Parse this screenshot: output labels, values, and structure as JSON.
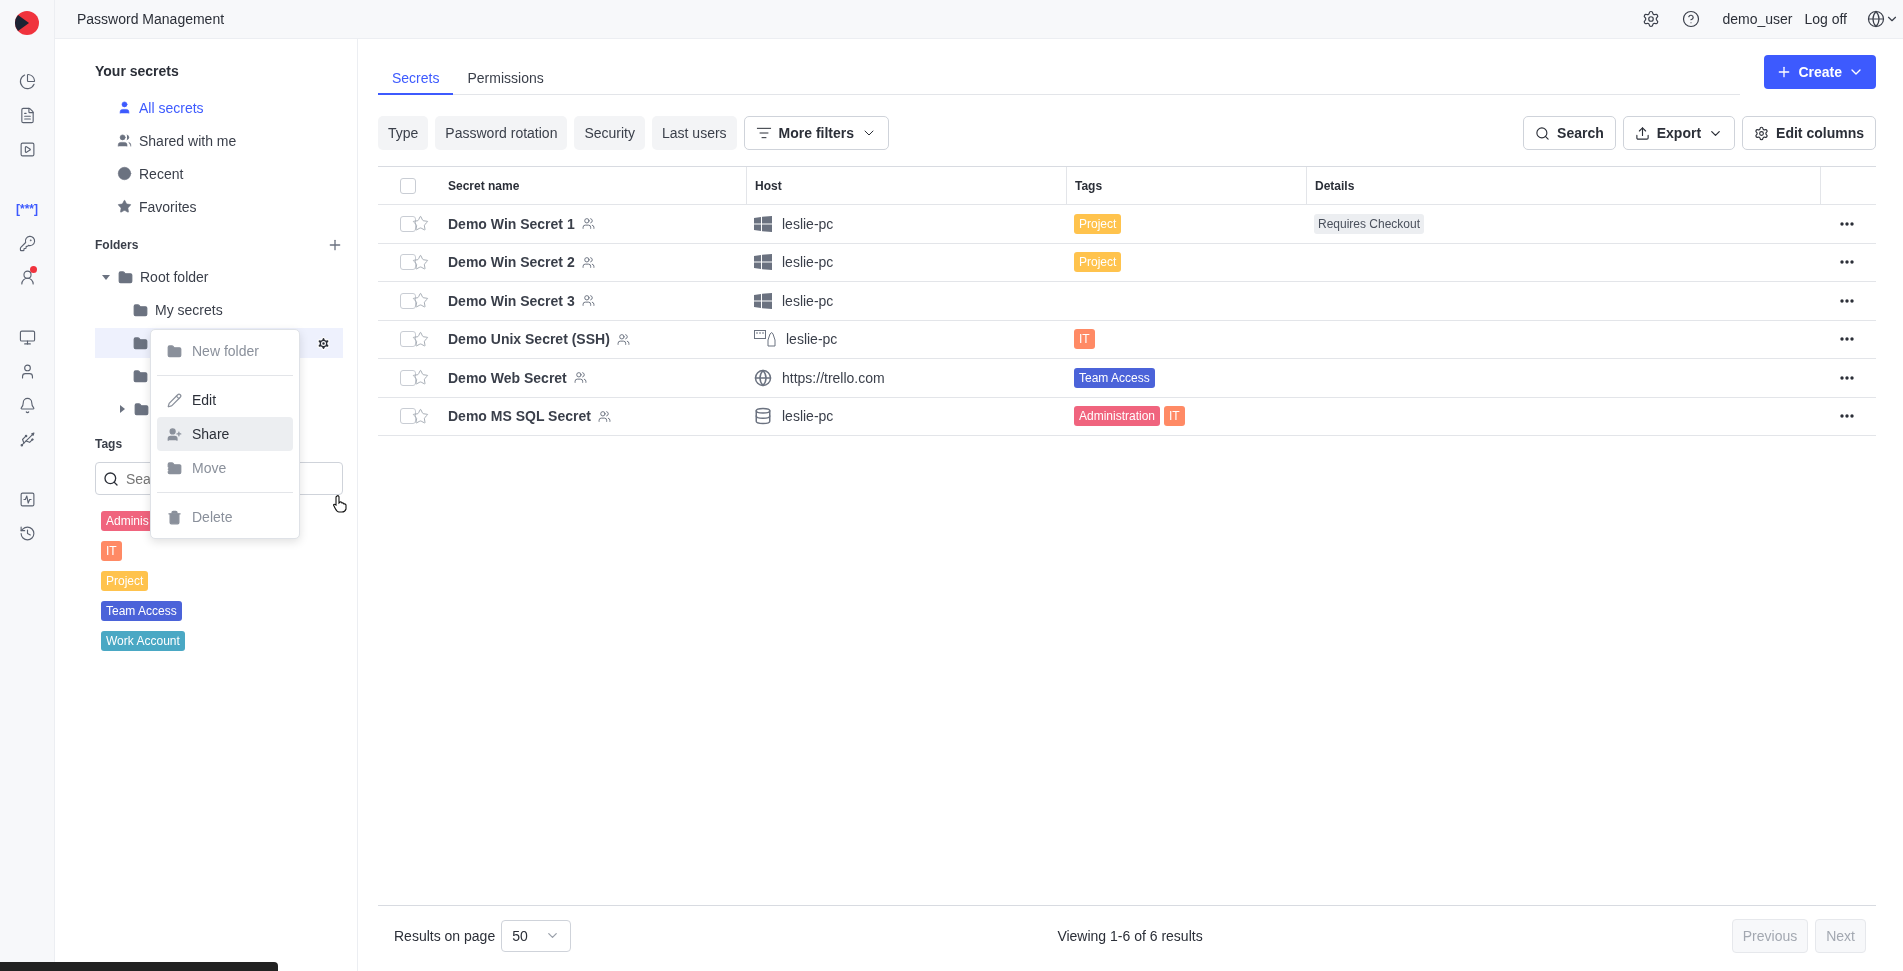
{
  "header": {
    "title": "Password Management",
    "user": "demo_user",
    "logoff": "Log off"
  },
  "rail": [
    {
      "selected": false
    },
    {
      "selected": false
    },
    {
      "selected": false
    },
    {
      "selected": true,
      "label": "[***]"
    },
    {
      "selected": false
    },
    {
      "selected": false,
      "badge": true
    },
    {
      "selected": false
    },
    {
      "selected": false
    },
    {
      "selected": false
    },
    {
      "selected": false
    },
    {
      "selected": false
    },
    {
      "selected": false
    }
  ],
  "sidebar": {
    "title": "Your secrets",
    "nav": [
      {
        "label": "All secrets",
        "selected": true
      },
      {
        "label": "Shared with me",
        "selected": false
      },
      {
        "label": "Recent",
        "selected": false
      },
      {
        "label": "Favorites",
        "selected": false
      }
    ],
    "folders_title": "Folders",
    "folders": [
      {
        "label": "Root folder",
        "expanded": true,
        "selected": false,
        "children": [
          {
            "label": "My secrets",
            "selected": false
          },
          {
            "selected": true
          },
          {
            "selected": false
          },
          {
            "selected": false,
            "expanded": false
          }
        ]
      }
    ],
    "tags_title": "Tags",
    "tag_search": {
      "placeholder": "Sea"
    },
    "tags": [
      {
        "label": "Adminis",
        "color": "#f0647e"
      },
      {
        "label": "IT",
        "color": "#ff8a65"
      },
      {
        "label": "Project",
        "color": "#ffc34d"
      },
      {
        "label": "Team Access",
        "color": "#4b63d9"
      },
      {
        "label": "Work Account",
        "color": "#4aa8c4"
      }
    ]
  },
  "context_menu": {
    "groups": [
      [
        {
          "label": "New folder",
          "disabled": true,
          "hovered": false
        }
      ],
      [
        {
          "label": "Edit",
          "disabled": false,
          "hovered": false
        },
        {
          "label": "Share",
          "disabled": false,
          "hovered": true
        },
        {
          "label": "Move",
          "disabled": true,
          "hovered": false
        }
      ],
      [
        {
          "label": "Delete",
          "disabled": true,
          "hovered": false
        }
      ]
    ]
  },
  "tabs": [
    {
      "label": "Secrets",
      "selected": true
    },
    {
      "label": "Permissions",
      "selected": false
    }
  ],
  "create_button": "Create",
  "filters": [
    "Type",
    "Password rotation",
    "Security",
    "Last users"
  ],
  "more_filters": "More filters",
  "actions": [
    "Search",
    "Export",
    "Edit columns"
  ],
  "table": {
    "columns": [
      "Secret name",
      "Host",
      "Tags",
      "Details"
    ],
    "header_checked": false,
    "rows": [
      {
        "name": "Demo Win Secret 1",
        "checked": false,
        "favorite": false,
        "host": {
          "kind": "windows",
          "text": "leslie-pc"
        },
        "tags": [
          {
            "label": "Project",
            "color": "#ffc34d"
          }
        ],
        "details": [
          "Requires Checkout"
        ]
      },
      {
        "name": "Demo Win Secret 2",
        "checked": false,
        "favorite": false,
        "host": {
          "kind": "windows",
          "text": "leslie-pc"
        },
        "tags": [
          {
            "label": "Project",
            "color": "#ffc34d"
          }
        ]
      },
      {
        "name": "Demo Win Secret 3",
        "checked": false,
        "favorite": false,
        "host": {
          "kind": "windows",
          "text": "leslie-pc"
        },
        "tags": []
      },
      {
        "name": "Demo Unix Secret (SSH)",
        "checked": false,
        "favorite": false,
        "host": {
          "kind": "unix",
          "text": "leslie-pc"
        },
        "tags": [
          {
            "label": "IT",
            "color": "#ff8a65"
          }
        ]
      },
      {
        "name": "Demo Web Secret",
        "checked": false,
        "favorite": false,
        "host": {
          "kind": "web",
          "text": "https://trello.com"
        },
        "tags": [
          {
            "label": "Team Access",
            "color": "#4b63d9"
          }
        ]
      },
      {
        "name": "Demo MS SQL Secret",
        "checked": false,
        "favorite": false,
        "host": {
          "kind": "database",
          "text": "leslie-pc"
        },
        "tags": [
          {
            "label": "Administration",
            "color": "#f0647e"
          },
          {
            "label": "IT",
            "color": "#ff8a65"
          }
        ]
      }
    ]
  },
  "footer": {
    "results_label": "Results on page",
    "page_size": "50",
    "summary": "Viewing 1-6 of 6 results",
    "previous": {
      "label": "Previous",
      "disabled": true
    },
    "next": {
      "label": "Next",
      "disabled": true
    }
  }
}
